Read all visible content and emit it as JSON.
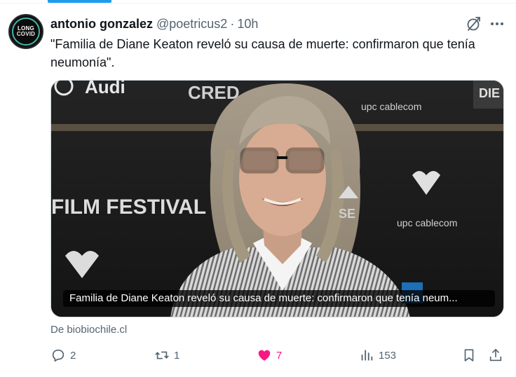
{
  "tweet": {
    "author_name": "antonio gonzalez",
    "author_handle": "@poetricus2",
    "separator": "·",
    "time": "10h",
    "avatar_text_line1": "LONG",
    "avatar_text_line2": "COVID",
    "text": "\"Familia de Diane Keaton reveló su causa de muerte: confirmaron que tenía neumonía\"."
  },
  "card": {
    "caption": "Familia de Diane Keaton reveló su causa de muerte: confirmaron que tenía neum...",
    "backdrop_text_left": "FILM FESTIVAL",
    "backdrop_brand": "Audi",
    "backdrop_sponsor": "upc cablecom",
    "source": "De biobiochile.cl"
  },
  "actions": {
    "reply_count": "2",
    "retweet_count": "1",
    "like_count": "7",
    "views_count": "153"
  },
  "colors": {
    "accent": "#1d9bf0",
    "like": "#f91880",
    "muted": "#536471"
  },
  "icons": [
    "grok-icon",
    "more-icon",
    "reply-icon",
    "retweet-icon",
    "heart-icon",
    "views-icon",
    "bookmark-icon",
    "share-icon"
  ]
}
